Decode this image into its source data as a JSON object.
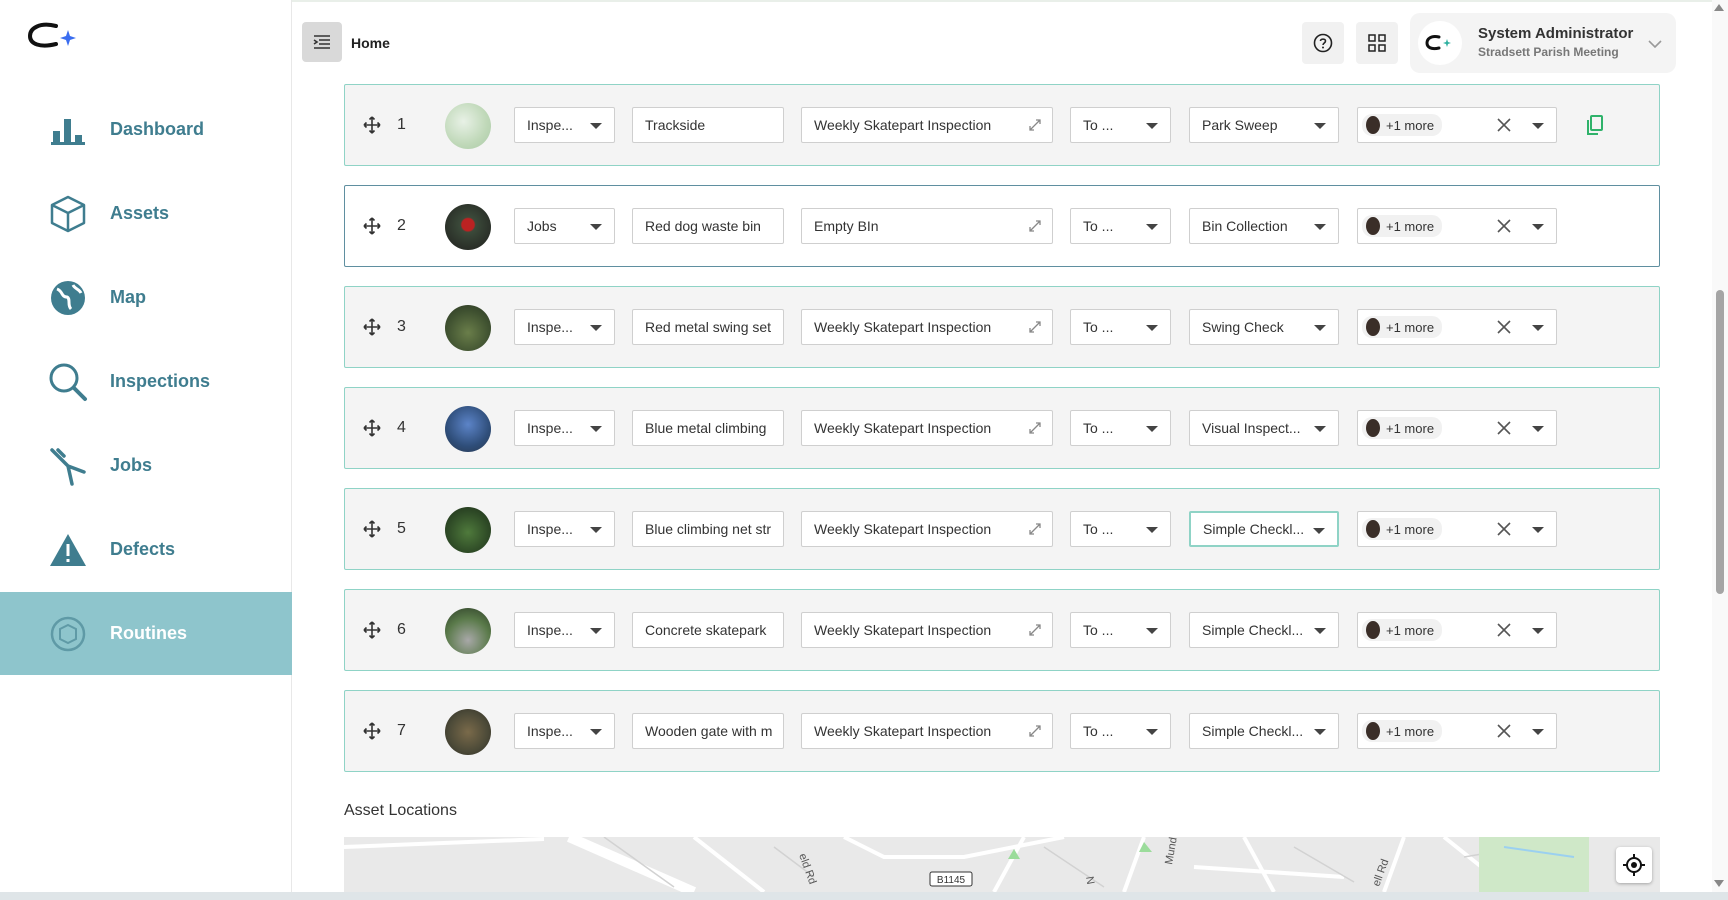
{
  "header": {
    "breadcrumb": "Home",
    "user_name": "System Administrator",
    "user_org": "Stradsett Parish Meeting"
  },
  "nav": [
    {
      "label": "Dashboard",
      "icon": "dashboard-icon"
    },
    {
      "label": "Assets",
      "icon": "cube-icon"
    },
    {
      "label": "Map",
      "icon": "globe-icon"
    },
    {
      "label": "Inspections",
      "icon": "magnifier-icon"
    },
    {
      "label": "Jobs",
      "icon": "tools-icon"
    },
    {
      "label": "Defects",
      "icon": "warning-icon"
    },
    {
      "label": "Routines",
      "icon": "routine-icon",
      "active": true
    }
  ],
  "rows": [
    {
      "num": "1",
      "type": "Inspe...",
      "asset": "Trackside",
      "routine": "Weekly Skatepart Inspection",
      "to": "To ...",
      "check": "Park Sweep",
      "users": "+1 more"
    },
    {
      "num": "2",
      "type": "Jobs",
      "asset": "Red dog waste bin",
      "routine": "Empty BIn",
      "to": "To ...",
      "check": "Bin Collection",
      "users": "+1 more"
    },
    {
      "num": "3",
      "type": "Inspe...",
      "asset": "Red metal swing set",
      "routine": "Weekly Skatepart Inspection",
      "to": "To ...",
      "check": "Swing Check",
      "users": "+1 more"
    },
    {
      "num": "4",
      "type": "Inspe...",
      "asset": "Blue metal climbing",
      "routine": "Weekly Skatepart Inspection",
      "to": "To ...",
      "check": "Visual Inspect...",
      "users": "+1 more"
    },
    {
      "num": "5",
      "type": "Inspe...",
      "asset": "Blue climbing net str",
      "routine": "Weekly Skatepart Inspection",
      "to": "To ...",
      "check": "Simple Checkl...",
      "users": "+1 more"
    },
    {
      "num": "6",
      "type": "Inspe...",
      "asset": "Concrete skatepark",
      "routine": "Weekly Skatepart Inspection",
      "to": "To ...",
      "check": "Simple Checkl...",
      "users": "+1 more"
    },
    {
      "num": "7",
      "type": "Inspe...",
      "asset": "Wooden gate with m",
      "routine": "Weekly Skatepart Inspection",
      "to": "To ...",
      "check": "Simple Checkl...",
      "users": "+1 more"
    }
  ],
  "section": {
    "asset_locations": "Asset Locations"
  },
  "map": {
    "road_labels": [
      "eld Rd",
      "B1145",
      "Mund",
      "ell Rd",
      "N"
    ]
  },
  "colors": {
    "accent": "#8ec5cc",
    "nav_text": "#3f7d8f",
    "row_border": "#8fd3c6",
    "brand_blue": "#3a6df0"
  }
}
